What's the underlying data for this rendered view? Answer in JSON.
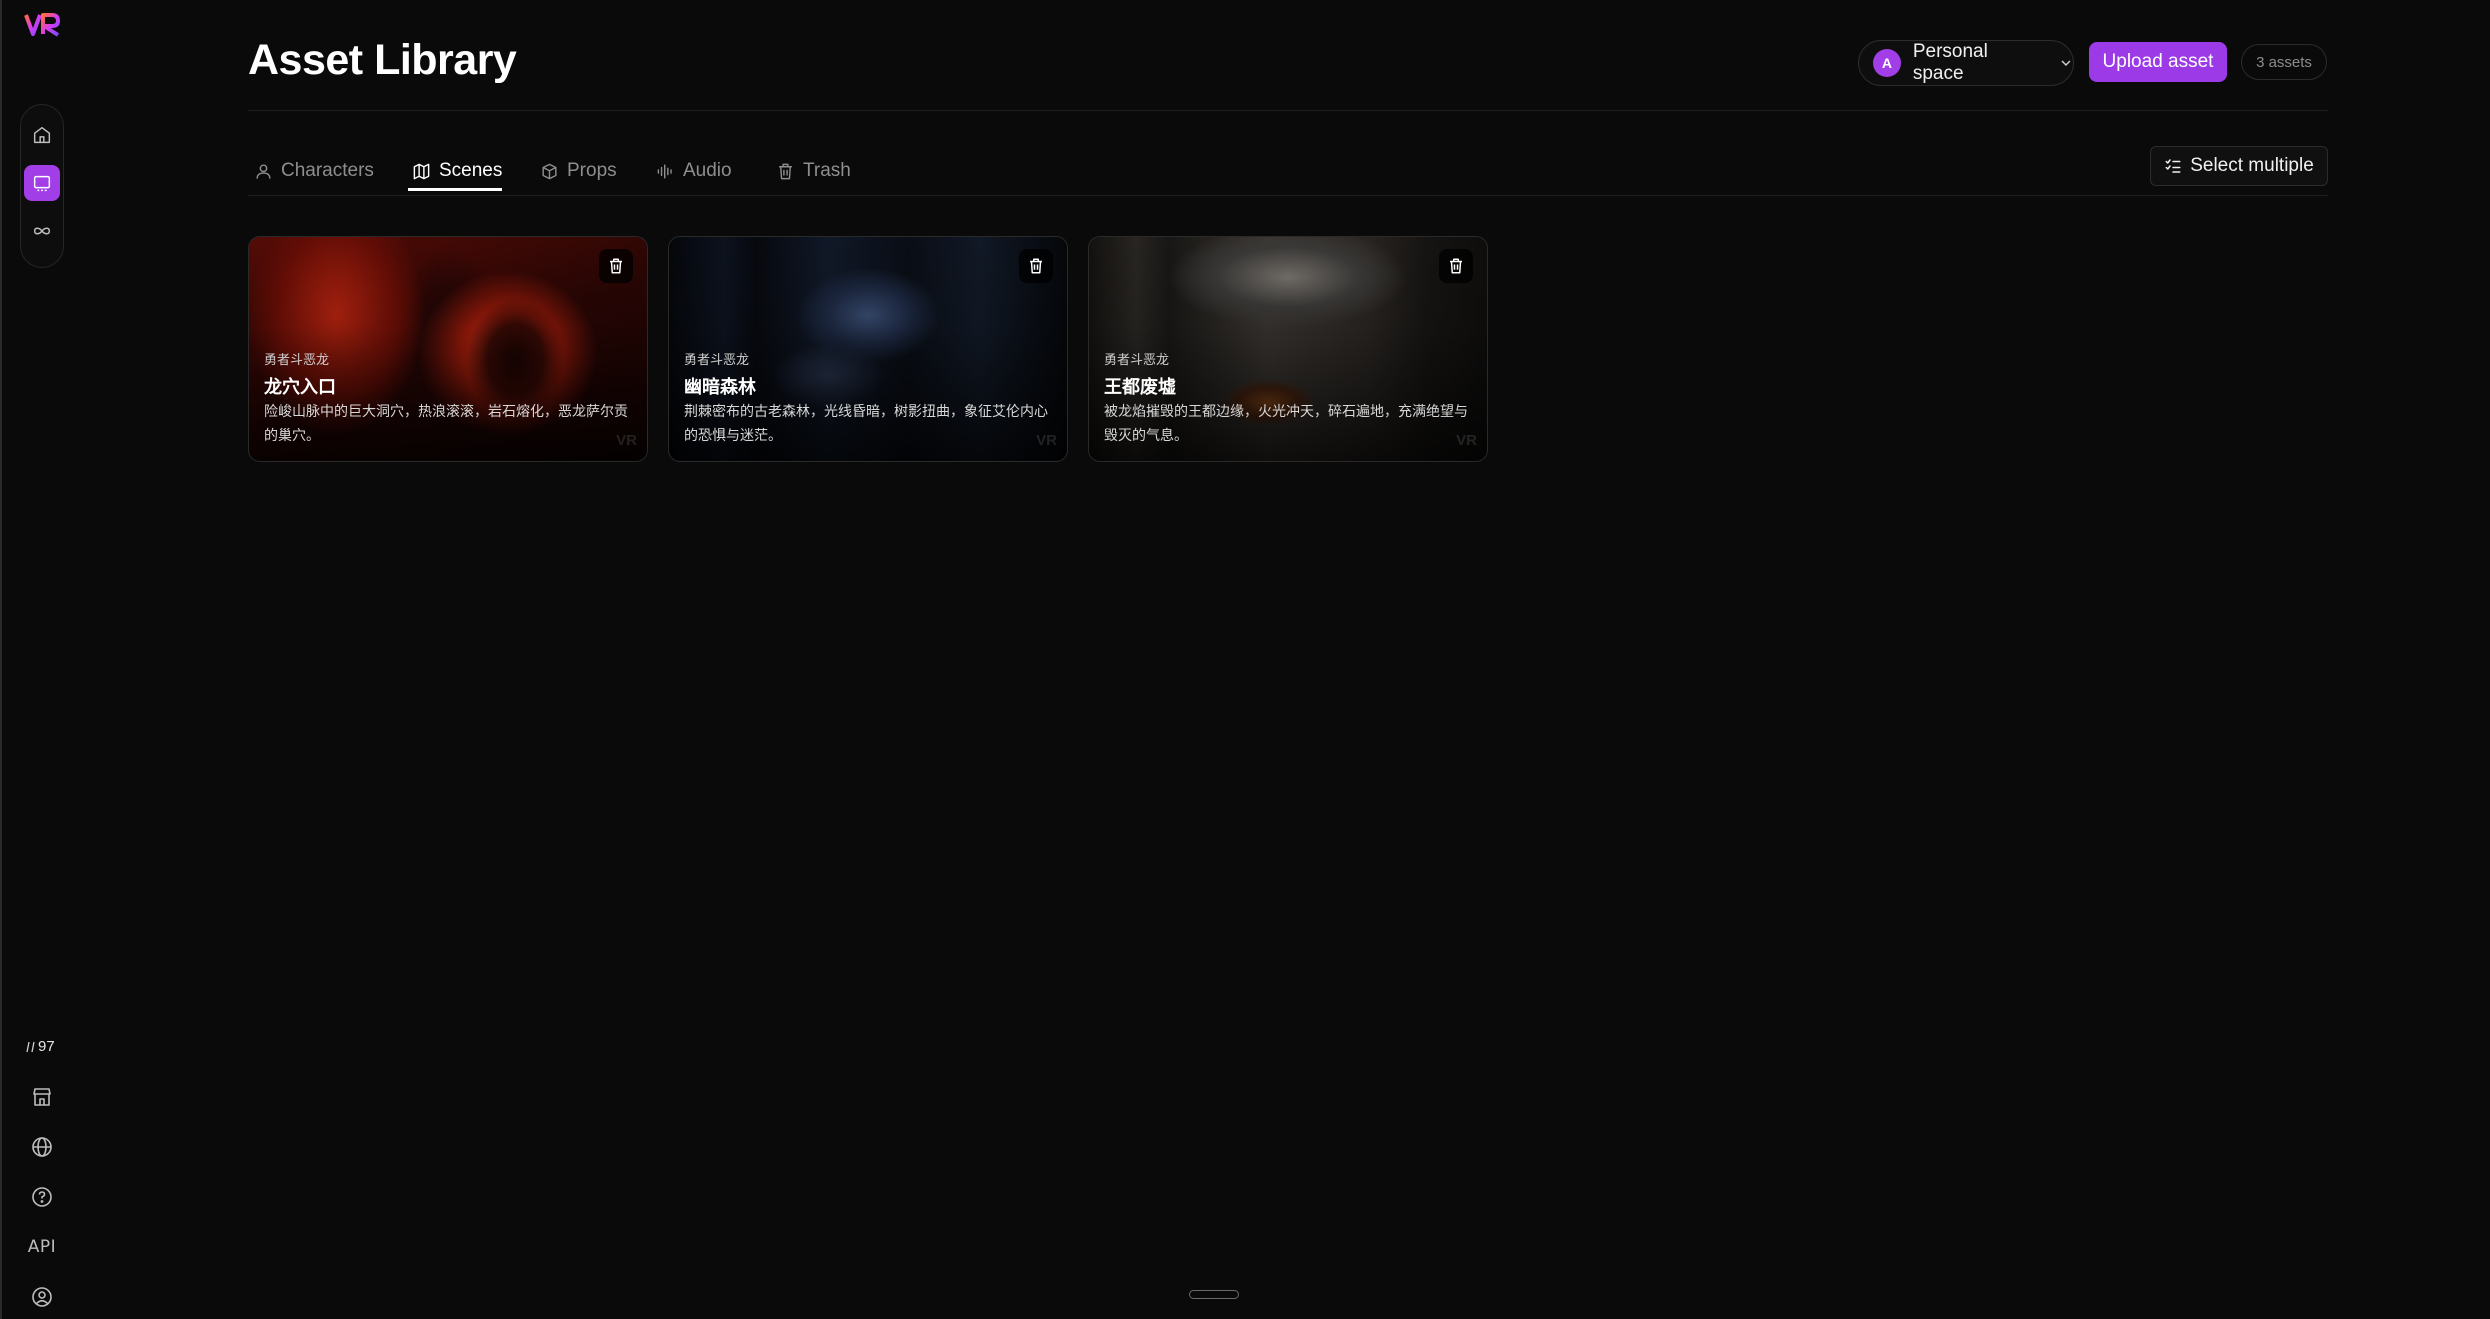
{
  "app": {
    "logo_text": "VR",
    "credits": "97"
  },
  "sidebar": {
    "nav": [
      {
        "name": "home-icon",
        "active": false
      },
      {
        "name": "asset-library-icon",
        "active": true
      },
      {
        "name": "infinity-icon",
        "active": false
      }
    ],
    "bottom": [
      {
        "name": "store-icon"
      },
      {
        "name": "globe-icon"
      },
      {
        "name": "help-icon"
      },
      {
        "name": "api-icon",
        "label": "API"
      },
      {
        "name": "account-icon"
      }
    ]
  },
  "header": {
    "title": "Asset Library",
    "workspace": {
      "avatar": "A",
      "label": "Personal space"
    },
    "upload_label": "Upload asset",
    "asset_count": "3 assets"
  },
  "tabs": [
    {
      "label": "Characters",
      "icon": "user-icon",
      "active": false
    },
    {
      "label": "Scenes",
      "icon": "map-icon",
      "active": true
    },
    {
      "label": "Props",
      "icon": "box-icon",
      "active": false
    },
    {
      "label": "Audio",
      "icon": "waveform-icon",
      "active": false
    },
    {
      "label": "Trash",
      "icon": "trash-icon",
      "active": false
    }
  ],
  "toolbar": {
    "select_multiple_label": "Select multiple"
  },
  "cards": [
    {
      "project": "勇者斗恶龙",
      "name": "龙穴入口",
      "description": "险峻山脉中的巨大洞穴，热浪滚滚，岩石熔化，恶龙萨尔贡的巢穴。",
      "watermark": "VR"
    },
    {
      "project": "勇者斗恶龙",
      "name": "幽暗森林",
      "description": "荆棘密布的古老森林，光线昏暗，树影扭曲，象征艾伦内心的恐惧与迷茫。",
      "watermark": "VR"
    },
    {
      "project": "勇者斗恶龙",
      "name": "王都废墟",
      "description": "被龙焰摧毁的王都边缘，火光冲天，碎石遍地，充满绝望与毁灭的气息。",
      "watermark": "VR"
    }
  ],
  "colors": {
    "background": "#0a0a0a",
    "accent": "#9b3ae6",
    "border": "#2a2a2a",
    "muted_text": "#8e8e8e"
  }
}
